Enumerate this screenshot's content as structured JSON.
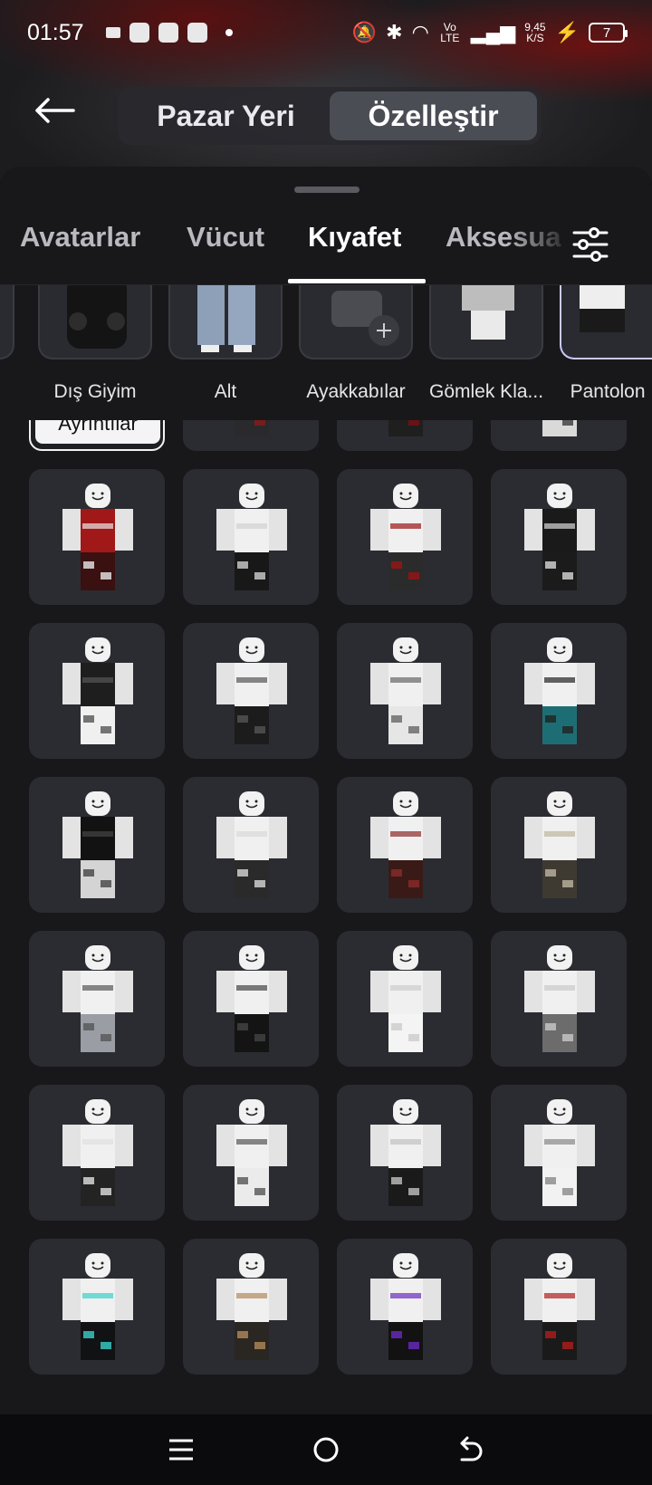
{
  "status_bar": {
    "time": "01:57",
    "network": "Vo LTE",
    "speed_value": "9,45",
    "speed_unit": "K/S",
    "battery": "7"
  },
  "header": {
    "segments": [
      {
        "label": "Pazar Yeri",
        "active": false
      },
      {
        "label": "Özelleştir",
        "active": true
      }
    ]
  },
  "tabs": [
    {
      "label": "Avatarlar"
    },
    {
      "label": "Vücut"
    },
    {
      "label": "Kıyafet",
      "active": true
    },
    {
      "label": "Aksesua"
    }
  ],
  "categories": [
    {
      "label": "Dış Giyim"
    },
    {
      "label": "Alt"
    },
    {
      "label": "Ayakkabılar"
    },
    {
      "label": "Gömlek Kla..."
    },
    {
      "label": "Pantolon K"
    }
  ],
  "grid": {
    "details_label": "Ayrıntılar",
    "items": [
      {
        "torso": "#f0f0f0",
        "pants": "#1c1c1e",
        "accent": "#8a8a8a"
      },
      {
        "torso": "#f0f0f0",
        "pants": "#2a2a2c",
        "accent": "#8b1a1a"
      },
      {
        "torso": "#f0f0f0",
        "pants": "#1f1f20",
        "accent": "#7a1010"
      },
      {
        "torso": "#f0f0f0",
        "pants": "#d9d9d9",
        "accent": "#3a3a3a"
      },
      {
        "torso": "#a01818",
        "pants": "#3a1010",
        "accent": "#e8e8e8"
      },
      {
        "torso": "#f0f0f0",
        "pants": "#181818",
        "accent": "#d0d0d0"
      },
      {
        "torso": "#f0f0f0",
        "pants": "#2b2b2b",
        "accent": "#9b1414"
      },
      {
        "torso": "#1a1a1a",
        "pants": "#1b1b1b",
        "accent": "#d8d8d8"
      },
      {
        "torso": "#1e1e1e",
        "pants": "#f0f0f0",
        "accent": "#555"
      },
      {
        "torso": "#f0f0f0",
        "pants": "#1c1c1c",
        "accent": "#555"
      },
      {
        "torso": "#f0f0f0",
        "pants": "#e6e6e6",
        "accent": "#666"
      },
      {
        "torso": "#f0f0f0",
        "pants": "#1d6e74",
        "accent": "#222"
      },
      {
        "torso": "#121212",
        "pants": "#d4d4d4",
        "accent": "#444"
      },
      {
        "torso": "#f0f0f0",
        "pants": "#2a2a2a",
        "accent": "#d8d8d8"
      },
      {
        "torso": "#f0f0f0",
        "pants": "#3a1a16",
        "accent": "#8b2a2a"
      },
      {
        "torso": "#f0f0f0",
        "pants": "#3e3a32",
        "accent": "#bdb59e"
      },
      {
        "torso": "#f0f0f0",
        "pants": "#9a9ea4",
        "accent": "#555"
      },
      {
        "torso": "#f0f0f0",
        "pants": "#141414",
        "accent": "#444"
      },
      {
        "torso": "#f0f0f0",
        "pants": "#f4f4f4",
        "accent": "#ccc"
      },
      {
        "torso": "#f0f0f0",
        "pants": "#6c6c6c",
        "accent": "#c9c9c9"
      },
      {
        "torso": "#f0f0f0",
        "pants": "#232323",
        "accent": "#e0e0e0"
      },
      {
        "torso": "#f0f0f0",
        "pants": "#ebebeb",
        "accent": "#555"
      },
      {
        "torso": "#f0f0f0",
        "pants": "#1a1a1a",
        "accent": "#c0c0c0"
      },
      {
        "torso": "#f0f0f0",
        "pants": "#f2f2f2",
        "accent": "#888"
      },
      {
        "torso": "#f0f0f0",
        "pants": "#101214",
        "accent": "#3ad0c8"
      },
      {
        "torso": "#f0f0f0",
        "pants": "#2a2622",
        "accent": "#b28a5a"
      },
      {
        "torso": "#f0f0f0",
        "pants": "#121212",
        "accent": "#6a2ac0"
      },
      {
        "torso": "#f0f0f0",
        "pants": "#1a1a1a",
        "accent": "#b01c1c"
      }
    ]
  },
  "colors": {
    "panel": "#18181b",
    "tile": "#2b2c31",
    "active_segment": "#4b4d55"
  },
  "icons": {
    "back": "arrow-left-icon",
    "filter": "sliders-icon",
    "add": "plus-icon"
  }
}
